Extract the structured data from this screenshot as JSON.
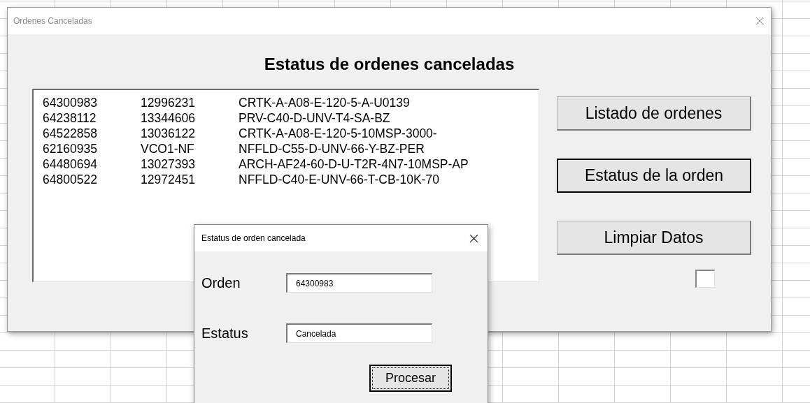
{
  "main_window": {
    "title": "Ordenes Canceladas",
    "heading": "Estatus de ordenes canceladas",
    "list_rows": [
      {
        "column_1": "64300983",
        "column_2": "12996231",
        "column_3": "CRTK-A-A08-E-120-5-A-U0139"
      },
      {
        "column_1": "64238112",
        "column_2": "13344606",
        "column_3": "PRV-C40-D-UNV-T4-SA-BZ"
      },
      {
        "column_1": "64522858",
        "column_2": "13036122",
        "column_3": "CRTK-A-A08-E-120-5-10MSP-3000-"
      },
      {
        "column_1": "62160935",
        "column_2": "VCO1-NF",
        "column_3": "NFFLD-C55-D-UNV-66-Y-BZ-PER"
      },
      {
        "column_1": "64480694",
        "column_2": "13027393",
        "column_3": "ARCH-AF24-60-D-U-T2R-4N7-10MSP-AP"
      },
      {
        "column_1": "64800522",
        "column_2": "12972451",
        "column_3": "NFFLD-C40-E-UNV-66-T-CB-10K-70"
      }
    ],
    "buttons": [
      {
        "label": "Listado de ordenes",
        "focused": false
      },
      {
        "label": "Estatus de la orden",
        "focused": true
      },
      {
        "label": "Limpiar Datos",
        "focused": false
      }
    ],
    "checkbox": {
      "checked": false
    }
  },
  "dialog": {
    "title": "Estatus de orden cancelada",
    "fields": [
      {
        "label": "Orden",
        "value": "64300983"
      },
      {
        "label": "Estatus",
        "value": "Cancelada"
      }
    ],
    "button": "Procesar"
  }
}
